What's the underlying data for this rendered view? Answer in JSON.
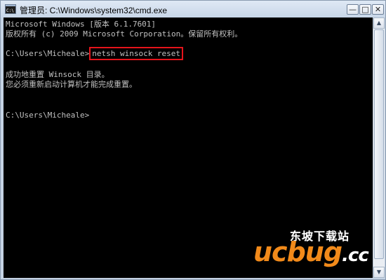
{
  "window": {
    "title": "管理员: C:\\Windows\\system32\\cmd.exe",
    "buttons": {
      "minimize": "—",
      "maximize": "□",
      "close": "✕"
    }
  },
  "console": {
    "lines": [
      "Microsoft Windows [版本 6.1.7601]",
      "版权所有 (c) 2009 Microsoft Corporation。保留所有权利。",
      "",
      "C:\\Users\\Micheale>",
      "",
      "成功地重置 Winsock 目录。",
      "您必须重新启动计算机才能完成重置。",
      "",
      "",
      "C:\\Users\\Micheale>"
    ],
    "highlighted_command": "netsh winsock reset"
  },
  "watermark": {
    "site_name": "东坡下载站",
    "logo_main": "ucbug",
    "logo_suffix": ".cc"
  },
  "colors": {
    "console_bg": "#000000",
    "console_text": "#c0c0c0",
    "highlight_border": "#e5141b",
    "logo_orange": "#f28a1a"
  },
  "icons": {
    "title": "cmd-icon",
    "scroll_up": "arrow-up-icon",
    "scroll_down": "arrow-down-icon"
  }
}
